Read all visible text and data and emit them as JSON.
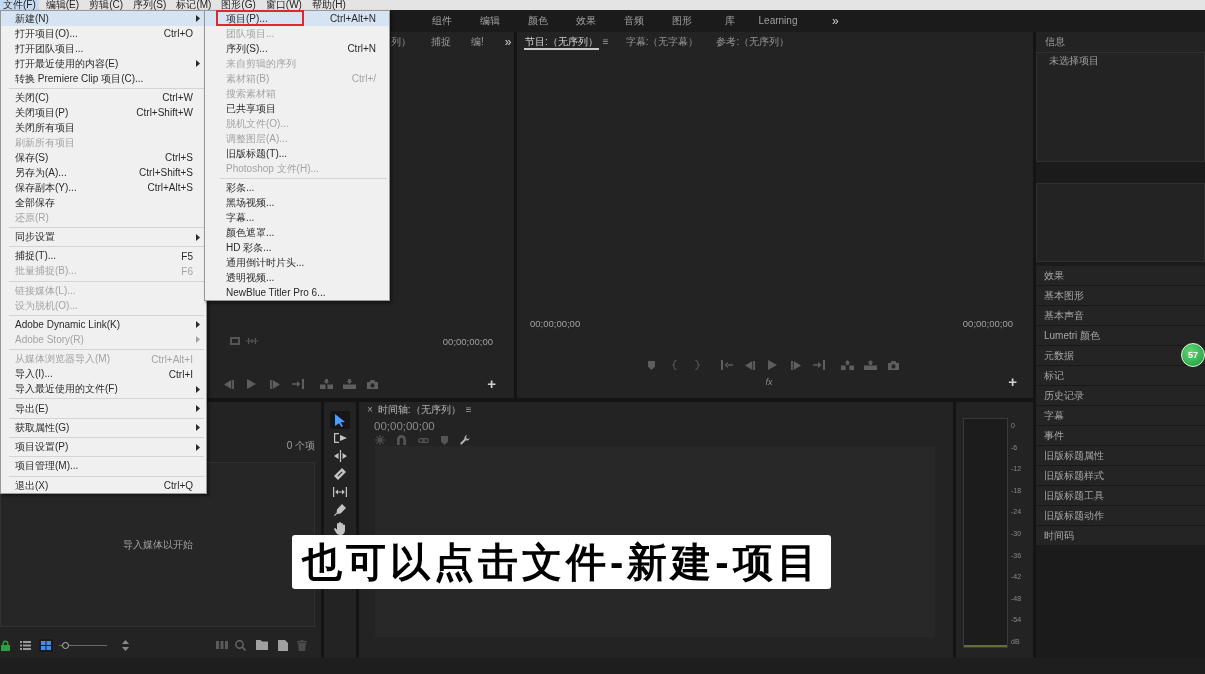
{
  "menubar": {
    "items": [
      {
        "label": "文件(F)",
        "selected": true
      },
      {
        "label": "编辑(E)",
        "selected": false
      },
      {
        "label": "剪辑(C)",
        "selected": false
      },
      {
        "label": "序列(S)",
        "selected": false
      },
      {
        "label": "标记(M)",
        "selected": false
      },
      {
        "label": "图形(G)",
        "selected": false
      },
      {
        "label": "窗口(W)",
        "selected": false
      },
      {
        "label": "帮助(H)",
        "selected": false
      }
    ]
  },
  "workspaces": {
    "items": [
      {
        "label": "组件",
        "selected": false
      },
      {
        "label": "编辑",
        "selected": false
      },
      {
        "label": "颜色",
        "selected": false
      },
      {
        "label": "效果",
        "selected": false
      },
      {
        "label": "音频",
        "selected": false
      },
      {
        "label": "图形",
        "selected": false
      },
      {
        "label": "库",
        "selected": false
      },
      {
        "label": "Learning",
        "selected": false
      }
    ],
    "more": "»"
  },
  "source_monitor": {
    "tabs": [
      {
        "label": "列）",
        "selected": false
      },
      {
        "label": "捕捉",
        "selected": false
      },
      {
        "label": "编!",
        "selected": false
      }
    ],
    "more": "»",
    "timecode": "00;00;00;00",
    "add": "+"
  },
  "program_monitor": {
    "tabs": [
      {
        "label": "节目:（无序列）",
        "selected": true
      },
      {
        "label": "字幕:（无字幕）",
        "selected": false
      },
      {
        "label": "参考:（无序列）",
        "selected": false
      }
    ],
    "tab_menu": "≡",
    "timecode_left": "00;00;00;00",
    "timecode_right": "00;00;00;00",
    "fx": "fx",
    "add": "+"
  },
  "project": {
    "count": "0 个项",
    "empty_message": "导入媒体以开始",
    "view_modes": [
      {
        "kind": "list",
        "selected": false
      },
      {
        "kind": "icon",
        "selected": true
      }
    ],
    "zoom": {
      "level": 0.08
    }
  },
  "tools": [
    {
      "kind": "select",
      "selected": true
    },
    {
      "kind": "track-select",
      "selected": false
    },
    {
      "kind": "ripple",
      "selected": false
    },
    {
      "kind": "razor",
      "selected": false
    },
    {
      "kind": "slip",
      "selected": false
    },
    {
      "kind": "pen",
      "selected": false
    },
    {
      "kind": "hand",
      "selected": false
    }
  ],
  "timeline": {
    "close": "×",
    "title": "时间轴:（无序列）",
    "menu": "≡",
    "timecode": "00;00;00;00"
  },
  "audio_meter": {
    "scale": [
      "0",
      "-6",
      "-12",
      "-18",
      "-24",
      "-30",
      "-36",
      "-42",
      "-48",
      "-54",
      "dB"
    ]
  },
  "right_panel": {
    "info_tab": "信息",
    "info_message": "未选择项目",
    "panels": [
      "效果",
      "基本图形",
      "基本声音",
      "Lumetri 颜色",
      "元数据",
      "标记",
      "历史记录",
      "字幕",
      "事件",
      "旧版标题属性",
      "旧版标题样式",
      "旧版标题工具",
      "旧版标题动作",
      "时间码"
    ]
  },
  "file_menu": {
    "items": [
      {
        "kind": "item",
        "label": "新建(N)",
        "submenu": true,
        "disabled": false,
        "selected": true
      },
      {
        "kind": "item",
        "label": "打开项目(O)...",
        "shortcut": "Ctrl+O",
        "submenu": false,
        "disabled": false,
        "selected": false
      },
      {
        "kind": "item",
        "label": "打开团队项目...",
        "submenu": false,
        "disabled": false,
        "selected": false
      },
      {
        "kind": "item",
        "label": "打开最近使用的内容(E)",
        "submenu": true,
        "disabled": false,
        "selected": false
      },
      {
        "kind": "item",
        "label": "转换 Premiere Clip 项目(C)...",
        "submenu": false,
        "disabled": false,
        "selected": false
      },
      {
        "kind": "separator"
      },
      {
        "kind": "item",
        "label": "关闭(C)",
        "shortcut": "Ctrl+W",
        "submenu": false,
        "disabled": false,
        "selected": false
      },
      {
        "kind": "item",
        "label": "关闭项目(P)",
        "shortcut": "Ctrl+Shift+W",
        "submenu": false,
        "disabled": false,
        "selected": false
      },
      {
        "kind": "item",
        "label": "关闭所有项目",
        "submenu": false,
        "disabled": false,
        "selected": false
      },
      {
        "kind": "item",
        "label": "刷新所有项目",
        "submenu": false,
        "disabled": true,
        "selected": false
      },
      {
        "kind": "item",
        "label": "保存(S)",
        "shortcut": "Ctrl+S",
        "submenu": false,
        "disabled": false,
        "selected": false
      },
      {
        "kind": "item",
        "label": "另存为(A)...",
        "shortcut": "Ctrl+Shift+S",
        "submenu": false,
        "disabled": false,
        "selected": false
      },
      {
        "kind": "item",
        "label": "保存副本(Y)...",
        "shortcut": "Ctrl+Alt+S",
        "submenu": false,
        "disabled": false,
        "selected": false
      },
      {
        "kind": "item",
        "label": "全部保存",
        "submenu": false,
        "disabled": false,
        "selected": false
      },
      {
        "kind": "item",
        "label": "还原(R)",
        "submenu": false,
        "disabled": true,
        "selected": false
      },
      {
        "kind": "separator"
      },
      {
        "kind": "item",
        "label": "同步设置",
        "submenu": true,
        "disabled": false,
        "selected": false
      },
      {
        "kind": "separator"
      },
      {
        "kind": "item",
        "label": "捕捉(T)...",
        "shortcut": "F5",
        "submenu": false,
        "disabled": false,
        "selected": false
      },
      {
        "kind": "item",
        "label": "批量捕捉(B)...",
        "shortcut": "F6",
        "submenu": false,
        "disabled": true,
        "selected": false
      },
      {
        "kind": "separator"
      },
      {
        "kind": "item",
        "label": "链接媒体(L)...",
        "submenu": false,
        "disabled": true,
        "selected": false
      },
      {
        "kind": "item",
        "label": "设为脱机(O)...",
        "submenu": false,
        "disabled": true,
        "selected": false
      },
      {
        "kind": "separator"
      },
      {
        "kind": "item",
        "label": "Adobe Dynamic Link(K)",
        "submenu": true,
        "disabled": false,
        "selected": false
      },
      {
        "kind": "item",
        "label": "Adobe Story(R)",
        "submenu": true,
        "disabled": true,
        "selected": false
      },
      {
        "kind": "separator"
      },
      {
        "kind": "item",
        "label": "从媒体浏览器导入(M)",
        "shortcut": "Ctrl+Alt+I",
        "submenu": false,
        "disabled": true,
        "selected": false
      },
      {
        "kind": "item",
        "label": "导入(I)...",
        "shortcut": "Ctrl+I",
        "submenu": false,
        "disabled": false,
        "selected": false
      },
      {
        "kind": "item",
        "label": "导入最近使用的文件(F)",
        "submenu": true,
        "disabled": false,
        "selected": false
      },
      {
        "kind": "separator"
      },
      {
        "kind": "item",
        "label": "导出(E)",
        "submenu": true,
        "disabled": false,
        "selected": false
      },
      {
        "kind": "separator"
      },
      {
        "kind": "item",
        "label": "获取属性(G)",
        "submenu": true,
        "disabled": false,
        "selected": false
      },
      {
        "kind": "separator"
      },
      {
        "kind": "item",
        "label": "项目设置(P)",
        "submenu": true,
        "disabled": false,
        "selected": false
      },
      {
        "kind": "separator"
      },
      {
        "kind": "item",
        "label": "项目管理(M)...",
        "submenu": false,
        "disabled": false,
        "selected": false
      },
      {
        "kind": "separator"
      },
      {
        "kind": "item",
        "label": "退出(X)",
        "shortcut": "Ctrl+Q",
        "submenu": false,
        "disabled": false,
        "selected": false
      }
    ]
  },
  "new_submenu": {
    "items": [
      {
        "kind": "item",
        "label": "项目(P)...",
        "shortcut": "Ctrl+Alt+N",
        "submenu": false,
        "disabled": false,
        "selected": true
      },
      {
        "kind": "item",
        "label": "团队项目...",
        "submenu": false,
        "disabled": true,
        "selected": false
      },
      {
        "kind": "item",
        "label": "序列(S)...",
        "shortcut": "Ctrl+N",
        "submenu": false,
        "disabled": false,
        "selected": false
      },
      {
        "kind": "item",
        "label": "来自剪辑的序列",
        "submenu": false,
        "disabled": true,
        "selected": false
      },
      {
        "kind": "item",
        "label": "素材箱(B)",
        "shortcut": "Ctrl+/",
        "submenu": false,
        "disabled": true,
        "selected": false
      },
      {
        "kind": "item",
        "label": "搜索素材箱",
        "submenu": false,
        "disabled": true,
        "selected": false
      },
      {
        "kind": "item",
        "label": "已共享项目",
        "submenu": false,
        "disabled": false,
        "selected": false
      },
      {
        "kind": "item",
        "label": "脱机文件(O)...",
        "submenu": false,
        "disabled": true,
        "selected": false
      },
      {
        "kind": "item",
        "label": "调整图层(A)...",
        "submenu": false,
        "disabled": true,
        "selected": false
      },
      {
        "kind": "item",
        "label": "旧版标题(T)...",
        "submenu": false,
        "disabled": false,
        "selected": false
      },
      {
        "kind": "item",
        "label": "Photoshop 文件(H)...",
        "submenu": false,
        "disabled": true,
        "selected": false
      },
      {
        "kind": "separator"
      },
      {
        "kind": "item",
        "label": "彩条...",
        "submenu": false,
        "disabled": false,
        "selected": false
      },
      {
        "kind": "item",
        "label": "黑场视频...",
        "submenu": false,
        "disabled": false,
        "selected": false
      },
      {
        "kind": "item",
        "label": "字幕...",
        "submenu": false,
        "disabled": false,
        "selected": false
      },
      {
        "kind": "item",
        "label": "颜色遮罩...",
        "submenu": false,
        "disabled": false,
        "selected": false
      },
      {
        "kind": "item",
        "label": "HD 彩条...",
        "submenu": false,
        "disabled": false,
        "selected": false
      },
      {
        "kind": "item",
        "label": "通用倒计时片头...",
        "submenu": false,
        "disabled": false,
        "selected": false
      },
      {
        "kind": "item",
        "label": "透明视频...",
        "submenu": false,
        "disabled": false,
        "selected": false
      },
      {
        "kind": "item",
        "label": "NewBlue Titler Pro 6...",
        "submenu": false,
        "disabled": false,
        "selected": false
      }
    ]
  },
  "caption": {
    "text": "也可以点击文件-新建-项目"
  },
  "badge": {
    "label": "57"
  }
}
